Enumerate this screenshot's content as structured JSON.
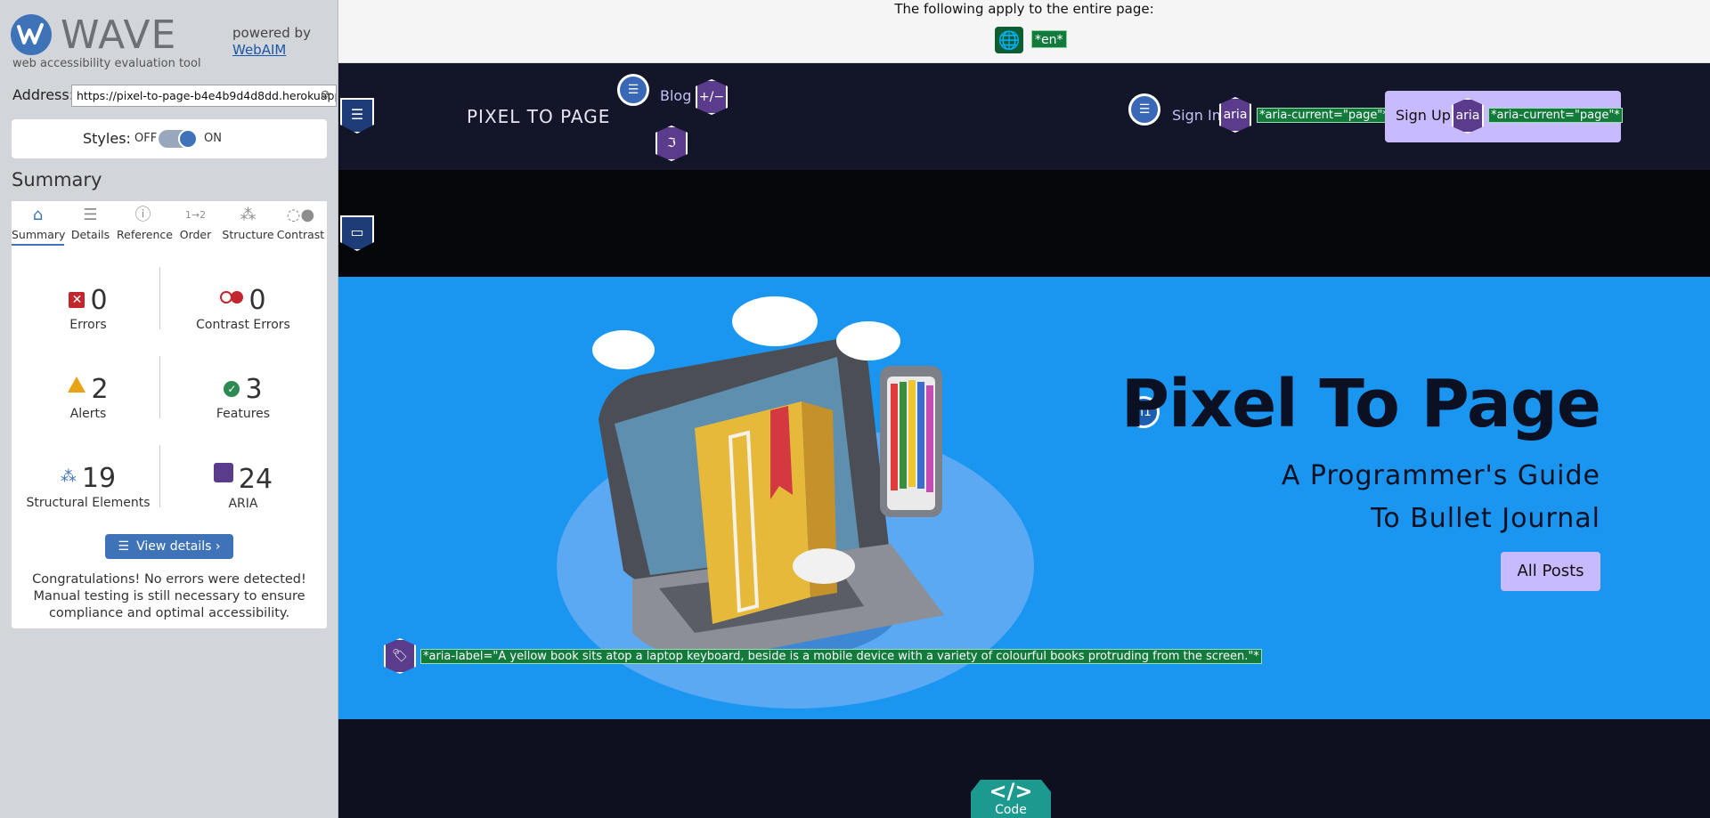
{
  "wave": {
    "logo_word": "WAVE",
    "tagline": "web accessibility evaluation tool",
    "powered_by": "powered by",
    "webaim": "WebAIM",
    "address_label": "Address:",
    "address_value": "https://pixel-to-page-b4e4b9d4d8dd.herokuapp.com/",
    "styles_label": "Styles:",
    "styles_off": "OFF",
    "styles_on": "ON",
    "summary_title": "Summary",
    "tabs": [
      {
        "label": "Summary",
        "icon": "home-icon"
      },
      {
        "label": "Details",
        "icon": "list-icon"
      },
      {
        "label": "Reference",
        "icon": "info-icon"
      },
      {
        "label": "Order",
        "icon": "order-icon"
      },
      {
        "label": "Structure",
        "icon": "hierarchy-icon"
      },
      {
        "label": "Contrast",
        "icon": "contrast-icon"
      }
    ],
    "stats": {
      "errors": {
        "value": "0",
        "label": "Errors"
      },
      "contrast_errors": {
        "value": "0",
        "label": "Contrast Errors"
      },
      "alerts": {
        "value": "2",
        "label": "Alerts"
      },
      "features": {
        "value": "3",
        "label": "Features"
      },
      "structural": {
        "value": "19",
        "label": "Structural Elements"
      },
      "aria": {
        "value": "24",
        "label": "ARIA"
      }
    },
    "view_details": "View details ›",
    "congrats": "Congratulations! No errors were detected! Manual testing is still necessary to ensure compliance and optimal accessibility.",
    "colors": {
      "accent": "#3f73b8",
      "error": "#c3272e",
      "alert": "#e8a316",
      "feature": "#2d8a52",
      "aria": "#5b3c8c"
    }
  },
  "page": {
    "doc_bar_text": "The following apply to the entire page:",
    "lang_badge": "*en*",
    "brand": "PIXEL TO PAGE",
    "nav": {
      "blog": "Blog",
      "sign_in": "Sign In",
      "sign_up": "Sign Up"
    },
    "aria_text": "aria",
    "aria_current": "*aria-current=\"page\"*",
    "h1_badge": "h1",
    "hero_title": "Pixel To Page",
    "hero_sub_1": "A Programmer's Guide",
    "hero_sub_2": "To Bullet Journal",
    "all_posts": "All Posts",
    "img_aria_label": "*aria-label=\"A yellow book sits atop a laptop keyboard, beside is a mobile device with a variety of colourful books protruding from the screen.\"*",
    "code_glyph": "</>",
    "code_label": "Code",
    "plusminus": "+/−",
    "colors": {
      "hero_bg": "#1a96f0",
      "nav_bg": "#121628",
      "button_bg": "#c8baff"
    }
  }
}
